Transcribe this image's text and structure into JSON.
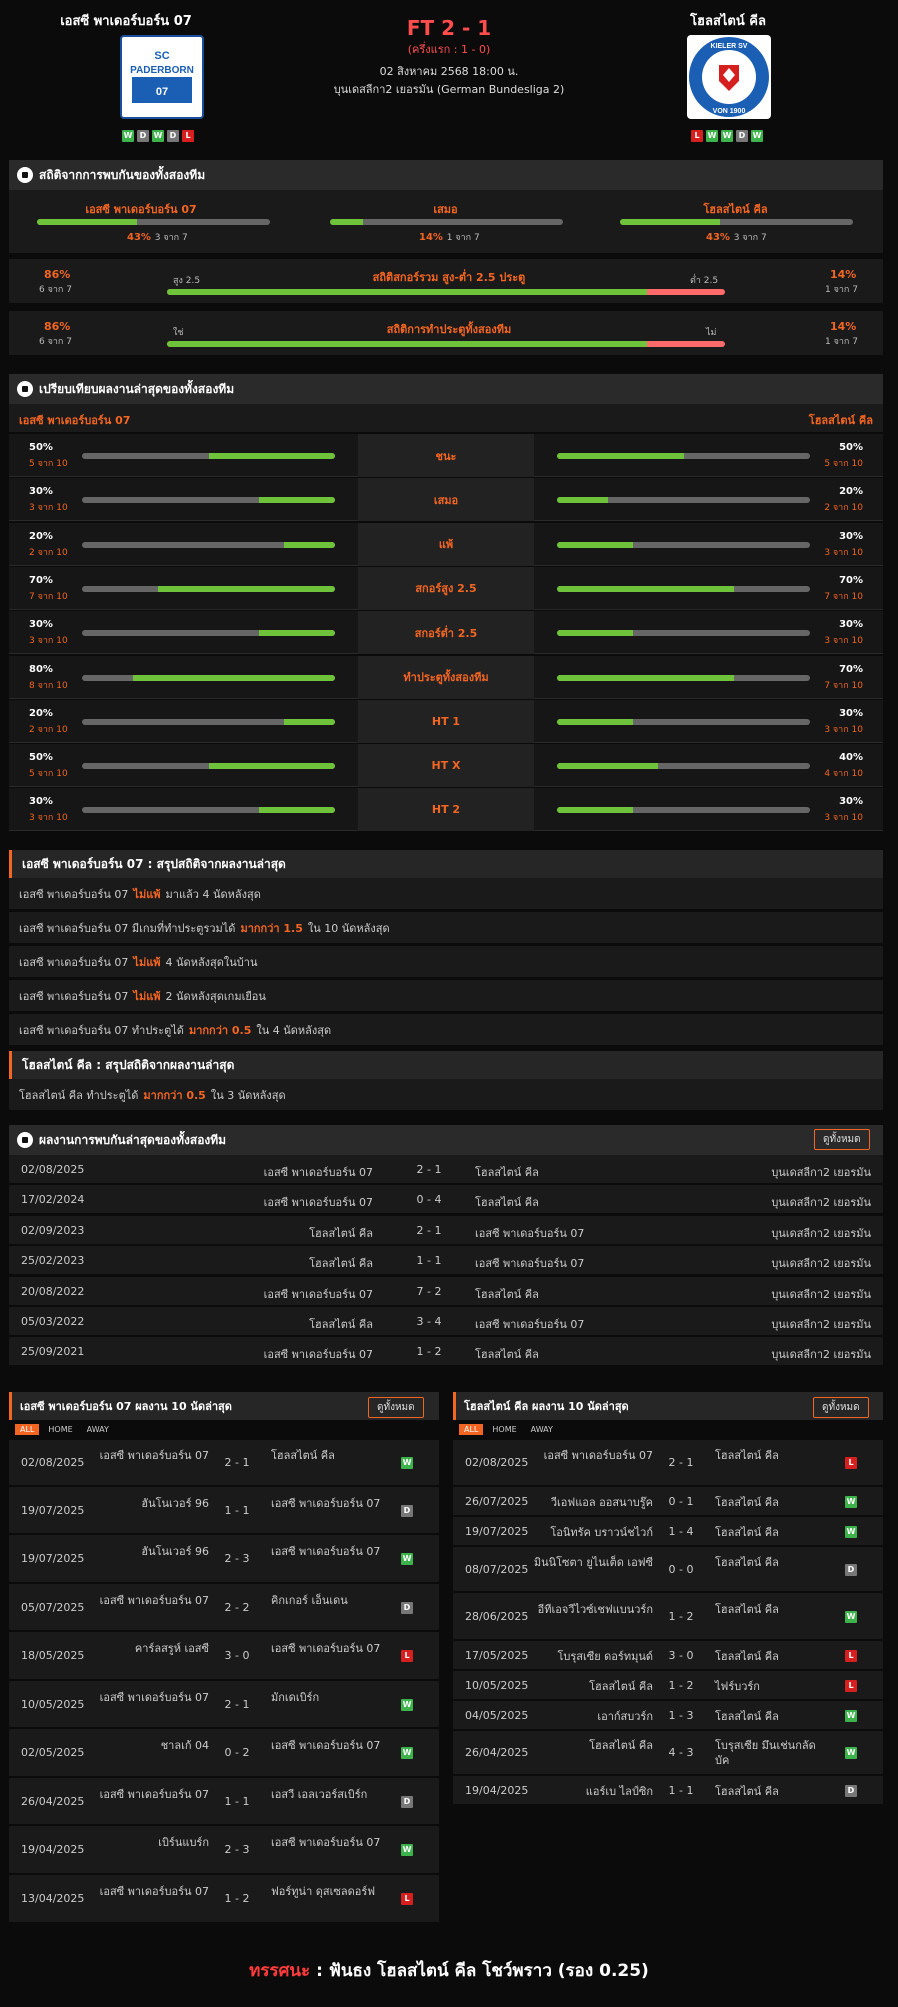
{
  "match": {
    "home": "เอสซี พาเดอร์บอร์น 07",
    "away": "โฮลสไตน์ คีล",
    "score": "FT 2 - 1",
    "halftime": "(ครึ่งแรก : 1 - 0)",
    "date": "02 สิงหาคม 2568 18:00 น.",
    "league": "บุนเดสลีกา2 เยอรมัน (German Bundesliga 2)",
    "home_form": [
      "W",
      "D",
      "W",
      "D",
      "L"
    ],
    "away_form": [
      "L",
      "W",
      "W",
      "D",
      "W"
    ],
    "home_logo_text": "SC PADERBORN 07",
    "away_logo_text": "KIELER SV HOLSTEIN VON 1900"
  },
  "h2h_stats": {
    "title": "สถิติจากการพบกันของทั้งสองทีม",
    "home": {
      "label": "เอสซี พาเดอร์บอร์น 07",
      "pct": "43%",
      "count": "3 จาก 7",
      "value": 0.43
    },
    "draw": {
      "label": "เสมอ",
      "pct": "14%",
      "count": "1 จาก 7",
      "value": 0.14
    },
    "away": {
      "label": "โฮลสไตน์ คีล",
      "pct": "43%",
      "count": "3 จาก 7",
      "value": 0.43
    },
    "ou": {
      "title": "สถิติสกอร์รวม สูง-ต่ำ 2.5 ประตู",
      "left_pct": "86%",
      "left_count": "6 จาก 7",
      "left_label": "สูง 2.5",
      "right_label": "ต่ำ 2.5",
      "right_pct": "14%",
      "right_count": "1 จาก 7",
      "value": 0.86
    },
    "btts": {
      "title": "สถิติการทำประตูทั้งสองทีม",
      "left_pct": "86%",
      "left_count": "6 จาก 7",
      "left_label": "ใช่",
      "right_label": "ไม่",
      "right_pct": "14%",
      "right_count": "1 จาก 7",
      "value": 0.86
    }
  },
  "compare": {
    "title": "เปรียบเทียบผลงานล่าสุดของทั้งสองทีม",
    "home": "เอสซี พาเดอร์บอร์น 07",
    "away": "โฮลสไตน์ คีล",
    "rows": [
      {
        "label": "ชนะ",
        "lp": "50%",
        "ls": "5 จาก 10",
        "lv": 0.5,
        "rp": "50%",
        "rs": "5 จาก 10",
        "rv": 0.5
      },
      {
        "label": "เสมอ",
        "lp": "30%",
        "ls": "3 จาก 10",
        "lv": 0.3,
        "rp": "20%",
        "rs": "2 จาก 10",
        "rv": 0.2
      },
      {
        "label": "แพ้",
        "lp": "20%",
        "ls": "2 จาก 10",
        "lv": 0.2,
        "rp": "30%",
        "rs": "3 จาก 10",
        "rv": 0.3
      },
      {
        "label": "สกอร์สูง 2.5",
        "lp": "70%",
        "ls": "7 จาก 10",
        "lv": 0.7,
        "rp": "70%",
        "rs": "7 จาก 10",
        "rv": 0.7
      },
      {
        "label": "สกอร์ต่ำ 2.5",
        "lp": "30%",
        "ls": "3 จาก 10",
        "lv": 0.3,
        "rp": "30%",
        "rs": "3 จาก 10",
        "rv": 0.3
      },
      {
        "label": "ทำประตูทั้งสองทีม",
        "lp": "80%",
        "ls": "8 จาก 10",
        "lv": 0.8,
        "rp": "70%",
        "rs": "7 จาก 10",
        "rv": 0.7
      },
      {
        "label": "HT 1",
        "lp": "20%",
        "ls": "2 จาก 10",
        "lv": 0.2,
        "rp": "30%",
        "rs": "3 จาก 10",
        "rv": 0.3
      },
      {
        "label": "HT X",
        "lp": "50%",
        "ls": "5 จาก 10",
        "lv": 0.5,
        "rp": "40%",
        "rs": "4 จาก 10",
        "rv": 0.4
      },
      {
        "label": "HT 2",
        "lp": "30%",
        "ls": "3 จาก 10",
        "lv": 0.3,
        "rp": "30%",
        "rs": "3 จาก 10",
        "rv": 0.3
      }
    ]
  },
  "home_summary": {
    "title": "เอสซี พาเดอร์บอร์น 07 : สรุปสถิติจากผลงานล่าสุด",
    "rows": [
      {
        "pre": "เอสซี พาเดอร์บอร์น 07",
        "hl": "ไม่แพ้",
        "post": "มาแล้ว 4 นัดหลังสุด"
      },
      {
        "pre": "เอสซี พาเดอร์บอร์น 07 มีเกมที่ทำประตูรวมได้",
        "hl": "มากกว่า 1.5",
        "post": "ใน 10 นัดหลังสุด"
      },
      {
        "pre": "เอสซี พาเดอร์บอร์น 07",
        "hl": "ไม่แพ้",
        "post": "4 นัดหลังสุดในบ้าน"
      },
      {
        "pre": "เอสซี พาเดอร์บอร์น 07",
        "hl": "ไม่แพ้",
        "post": "2 นัดหลังสุดเกมเยือน"
      },
      {
        "pre": "เอสซี พาเดอร์บอร์น 07 ทำประตูได้",
        "hl": "มากกว่า 0.5",
        "post": "ใน 4 นัดหลังสุด"
      }
    ]
  },
  "away_summary": {
    "title": "โฮลสไตน์ คีล : สรุปสถิติจากผลงานล่าสุด",
    "rows": [
      {
        "pre": "โฮลสไตน์ คีล ทำประตูได้",
        "hl": "มากกว่า 0.5",
        "post": "ใน 3 นัดหลังสุด"
      }
    ]
  },
  "h2h": {
    "title": "ผลงานการพบกันล่าสุดของทั้งสองทีม",
    "all_label": "ดูทั้งหมด",
    "rows": [
      {
        "date": "02/08/2025",
        "home": "เอสซี พาเดอร์บอร์น 07",
        "score": "2 - 1",
        "away": "โฮลสไตน์ คีล",
        "league": "บุนเดสลีกา2 เยอรมัน"
      },
      {
        "date": "17/02/2024",
        "home": "เอสซี พาเดอร์บอร์น 07",
        "score": "0 - 4",
        "away": "โฮลสไตน์ คีล",
        "league": "บุนเดสลีกา2 เยอรมัน"
      },
      {
        "date": "02/09/2023",
        "home": "โฮลสไตน์ คีล",
        "score": "2 - 1",
        "away": "เอสซี พาเดอร์บอร์น 07",
        "league": "บุนเดสลีกา2 เยอรมัน"
      },
      {
        "date": "25/02/2023",
        "home": "โฮลสไตน์ คีล",
        "score": "1 - 1",
        "away": "เอสซี พาเดอร์บอร์น 07",
        "league": "บุนเดสลีกา2 เยอรมัน"
      },
      {
        "date": "20/08/2022",
        "home": "เอสซี พาเดอร์บอร์น 07",
        "score": "7 - 2",
        "away": "โฮลสไตน์ คีล",
        "league": "บุนเดสลีกา2 เยอรมัน"
      },
      {
        "date": "05/03/2022",
        "home": "โฮลสไตน์ คีล",
        "score": "3 - 4",
        "away": "เอสซี พาเดอร์บอร์น 07",
        "league": "บุนเดสลีกา2 เยอรมัน"
      },
      {
        "date": "25/09/2021",
        "home": "เอสซี พาเดอร์บอร์น 07",
        "score": "1 - 2",
        "away": "โฮลสไตน์ คีล",
        "league": "บุนเดสลีกา2 เยอรมัน"
      }
    ]
  },
  "home_last10": {
    "title": "เอสซี พาเดอร์บอร์น 07 ผลงาน 10 นัดล่าสุด",
    "all_label": "ดูทั้งหมด",
    "tabs": [
      "ALL",
      "HOME",
      "AWAY"
    ],
    "rows": [
      {
        "date": "02/08/2025",
        "home": "เอสซี พาเดอร์บอร์น 07",
        "score": "2 - 1",
        "away": "โฮลสไตน์ คีล",
        "res": "W"
      },
      {
        "date": "19/07/2025",
        "home": "ฮันโนเวอร์ 96",
        "score": "1 - 1",
        "away": "เอสซี พาเดอร์บอร์น 07",
        "res": "D"
      },
      {
        "date": "19/07/2025",
        "home": "ฮันโนเวอร์ 96",
        "score": "2 - 3",
        "away": "เอสซี พาเดอร์บอร์น 07",
        "res": "W"
      },
      {
        "date": "05/07/2025",
        "home": "เอสซี พาเดอร์บอร์น 07",
        "score": "2 - 2",
        "away": "คิกเกอร์ เอ็นเดน",
        "res": "D"
      },
      {
        "date": "18/05/2025",
        "home": "คาร์ลสรูห์ เอสซี",
        "score": "3 - 0",
        "away": "เอสซี พาเดอร์บอร์น 07",
        "res": "L"
      },
      {
        "date": "10/05/2025",
        "home": "เอสซี พาเดอร์บอร์น 07",
        "score": "2 - 1",
        "away": "มักเดเบิร์ก",
        "res": "W"
      },
      {
        "date": "02/05/2025",
        "home": "ชาลเก้ 04",
        "score": "0 - 2",
        "away": "เอสซี พาเดอร์บอร์น 07",
        "res": "W"
      },
      {
        "date": "26/04/2025",
        "home": "เอสซี พาเดอร์บอร์น 07",
        "score": "1 - 1",
        "away": "เอสวี เอลเวอร์สเบิร์ก",
        "res": "D"
      },
      {
        "date": "19/04/2025",
        "home": "เบิร์นแบร์ก",
        "score": "2 - 3",
        "away": "เอสซี พาเดอร์บอร์น 07",
        "res": "W"
      },
      {
        "date": "13/04/2025",
        "home": "เอสซี พาเดอร์บอร์น 07",
        "score": "1 - 2",
        "away": "ฟอร์ทูน่า ดุสเซลดอร์ฟ",
        "res": "L"
      }
    ]
  },
  "away_last10": {
    "title": "โฮลสไตน์ คีล ผลงาน 10 นัดล่าสุด",
    "all_label": "ดูทั้งหมด",
    "tabs": [
      "ALL",
      "HOME",
      "AWAY"
    ],
    "rows": [
      {
        "date": "02/08/2025",
        "home": "เอสซี พาเดอร์บอร์น 07",
        "score": "2 - 1",
        "away": "โฮลสไตน์ คีล",
        "res": "L"
      },
      {
        "date": "26/07/2025",
        "home": "วีเอฟแอล ออสนาบรู๊ค",
        "score": "0 - 1",
        "away": "โฮลสไตน์ คีล",
        "res": "W"
      },
      {
        "date": "19/07/2025",
        "home": "โอนิทรัค บราวน์ชไวก์",
        "score": "1 - 4",
        "away": "โฮลสไตน์ คีล",
        "res": "W"
      },
      {
        "date": "08/07/2025",
        "home": "มินนิโซตา ยูไนเต็ด เอฟซี",
        "score": "0 - 0",
        "away": "โฮลสไตน์ คีล",
        "res": "D"
      },
      {
        "date": "28/06/2025",
        "home": "อีทีเอจวีไวซ์เชฟแบนวร์ก",
        "score": "1 - 2",
        "away": "โฮลสไตน์ คีล",
        "res": "W"
      },
      {
        "date": "17/05/2025",
        "home": "โบรุสเซีย ดอร์ทมุนด์",
        "score": "3 - 0",
        "away": "โฮลสไตน์ คีล",
        "res": "L"
      },
      {
        "date": "10/05/2025",
        "home": "โฮลสไตน์ คีล",
        "score": "1 - 2",
        "away": "ไฟร์บวร์ก",
        "res": "L"
      },
      {
        "date": "04/05/2025",
        "home": "เอาก์สบวร์ก",
        "score": "1 - 3",
        "away": "โฮลสไตน์ คีล",
        "res": "W"
      },
      {
        "date": "26/04/2025",
        "home": "โฮลสไตน์ คีล",
        "score": "4 - 3",
        "away": "โบรุสเซีย มึนเช่นกลัดบัค",
        "res": "W"
      },
      {
        "date": "19/04/2025",
        "home": "แอร์เบ ไลป์ซิก",
        "score": "1 - 1",
        "away": "โฮลสไตน์ คีล",
        "res": "D"
      }
    ]
  },
  "verdict": {
    "label": "ทรรศนะ",
    "sep": ":",
    "text": "ฟันธง โฮลสไตน์ คีล โชว์พราว (รอง 0.25)"
  },
  "colors": {
    "accent": "#f26522",
    "bar_green": "#6fc33a",
    "bar_red": "#ff6b6b",
    "bg": "#0b0b0b"
  }
}
